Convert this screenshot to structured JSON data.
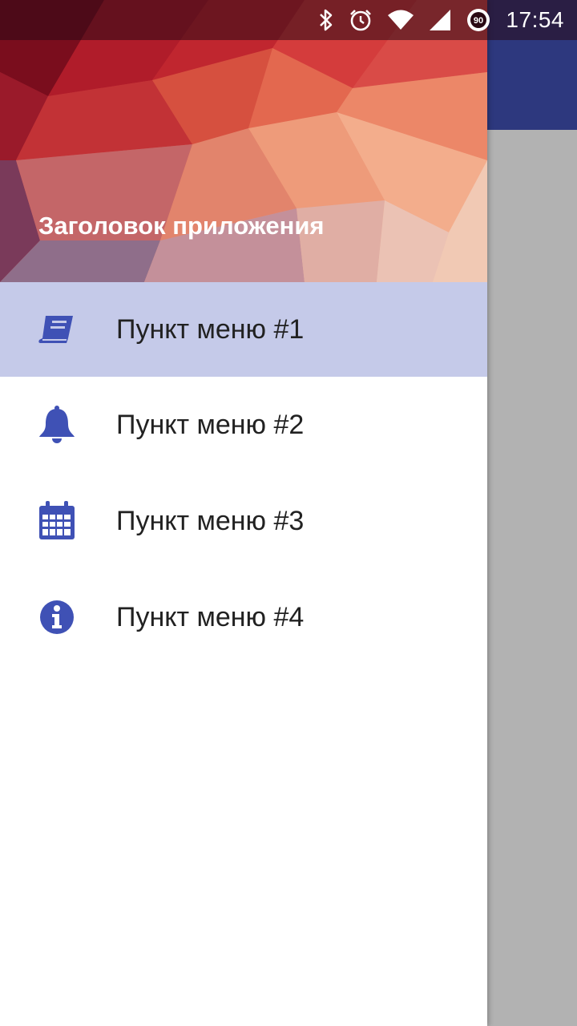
{
  "status_bar": {
    "time": "17:54",
    "icons": [
      "bluetooth-icon",
      "alarm-icon",
      "wifi-icon",
      "signal-icon",
      "battery-icon"
    ],
    "battery_level": "90"
  },
  "drawer": {
    "title": "Заголовок приложения",
    "items": [
      {
        "label": "Пункт меню #1",
        "icon": "book-icon",
        "selected": true
      },
      {
        "label": "Пункт меню #2",
        "icon": "bell-icon",
        "selected": false
      },
      {
        "label": "Пункт меню #3",
        "icon": "calendar-icon",
        "selected": false
      },
      {
        "label": "Пункт меню #4",
        "icon": "info-icon",
        "selected": false
      }
    ]
  },
  "colors": {
    "primary": "#2d387e",
    "accent_icon": "#3f51b5",
    "selected_bg": "#c5cae9",
    "scrim": "#b2b2b2"
  }
}
